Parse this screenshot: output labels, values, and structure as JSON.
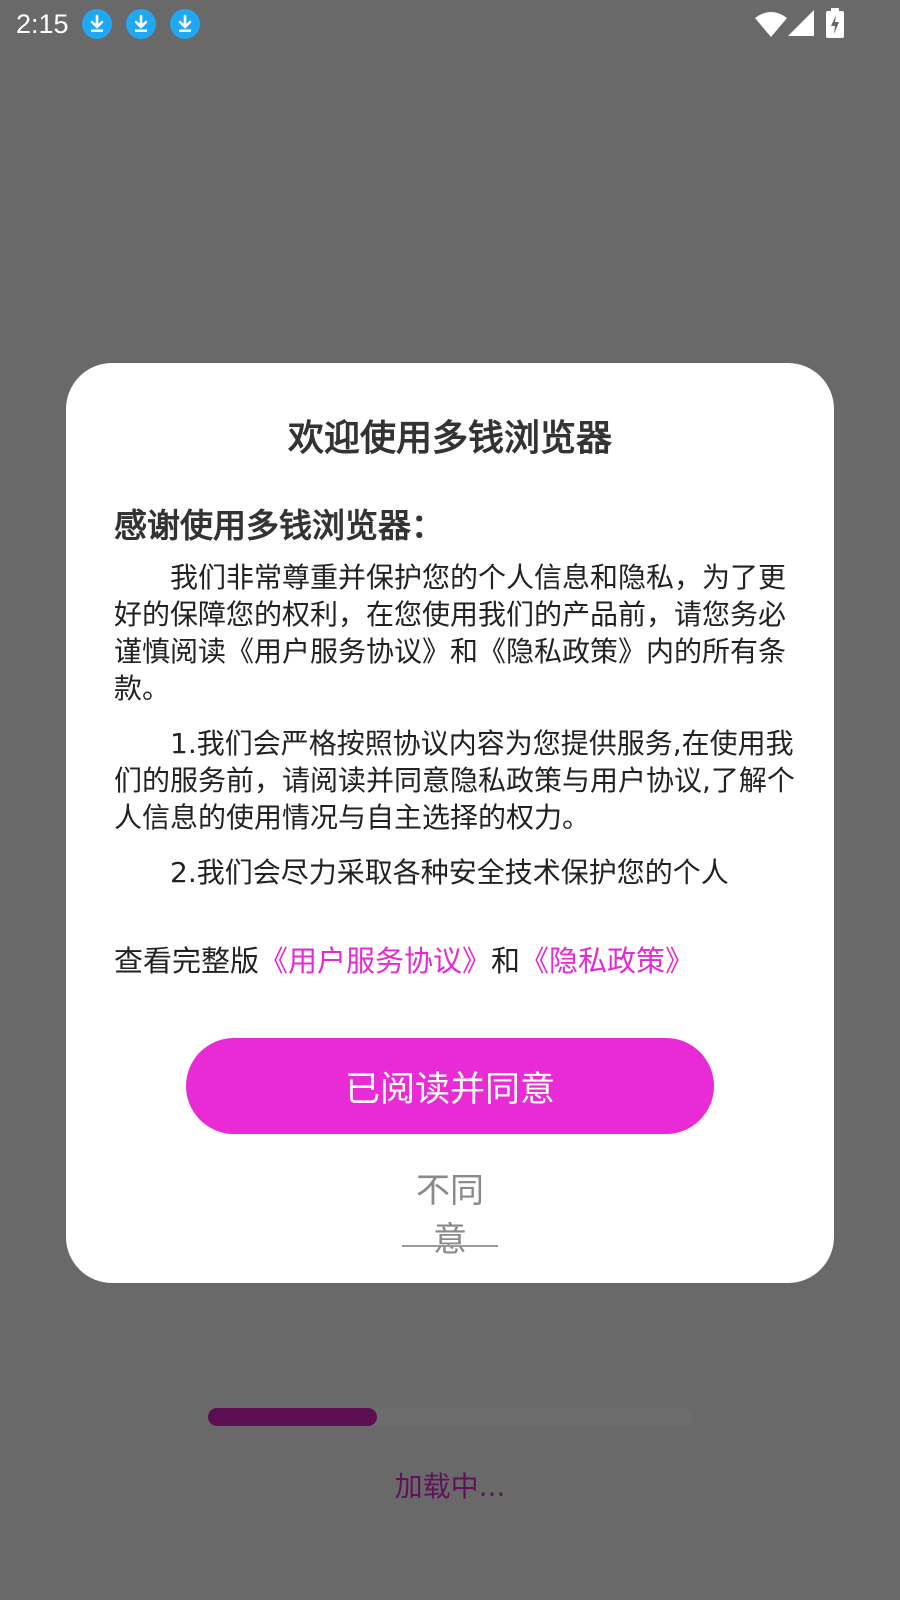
{
  "status_bar": {
    "time": "2:15",
    "notification_icons": [
      "download-icon",
      "download-icon",
      "download-icon"
    ],
    "system_icons": [
      "wifi-icon",
      "cellular-signal-icon",
      "battery-charging-icon"
    ]
  },
  "dialog": {
    "title": "欢迎使用多钱浏览器",
    "heading": "感谢使用多钱浏览器：",
    "paragraphs": [
      "我们非常尊重并保护您的个人信息和隐私，为了更好的保障您的权利，在您使用我们的产品前，请您务必谨慎阅读《用户服务协议》和《隐私政策》内的所有条款。",
      "1.我们会严格按照协议内容为您提供服务,在使用我们的服务前，请阅读并同意隐私政策与用户协议,了解个人信息的使用情况与自主选择的权力。",
      "2.我们会尽力采取各种安全技术保护您的个人"
    ],
    "full_version_prefix": "查看完整版",
    "user_agreement_link": "《用户服务协议》",
    "conjunction": "和",
    "privacy_policy_link": "《隐私政策》",
    "agree_label": "已阅读并同意",
    "disagree_label": "不同意"
  },
  "loading": {
    "text": "加载中...",
    "progress": 0.35
  },
  "colors": {
    "accent": "#e92bd5",
    "overlay": "#696969",
    "progress_fill": "#5d0d52",
    "loading_text": "#5f1257"
  }
}
